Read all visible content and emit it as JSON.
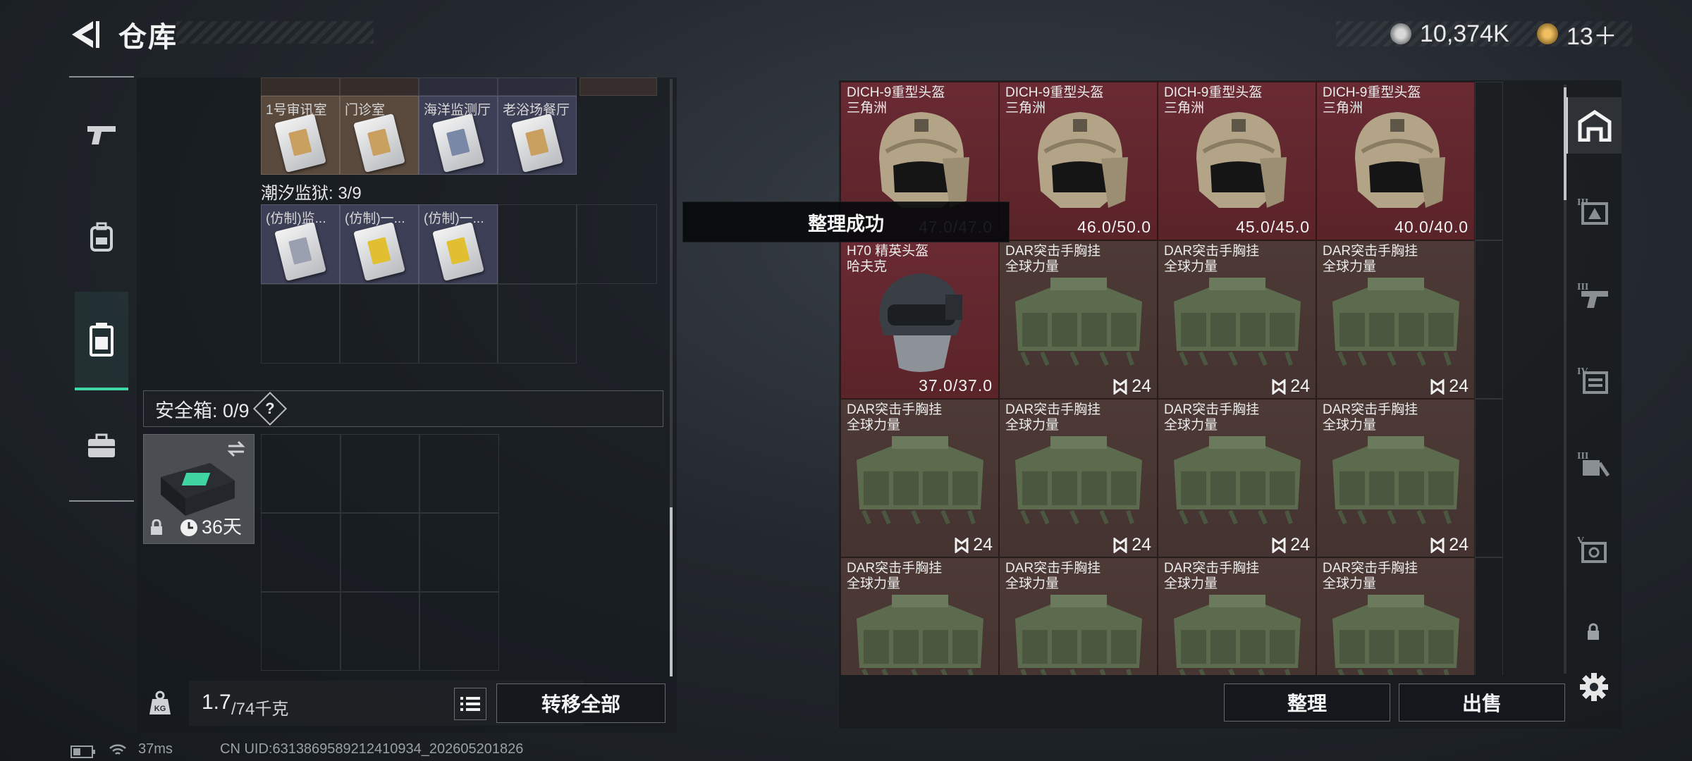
{
  "header": {
    "title": "仓库",
    "currency_1": "10,374K",
    "currency_2": "13＋"
  },
  "nav": {
    "items": [
      "weapon",
      "backpack",
      "vest",
      "case"
    ],
    "active": "vest"
  },
  "storage": {
    "room_row_labels": [
      "1号审讯室",
      "门诊室",
      "海洋监测厅",
      "老浴场餐厅"
    ],
    "prison_label": "潮汐监狱: 3/9",
    "prison_items": [
      "(仿制)监...",
      "(仿制)一...",
      "(仿制)一..."
    ],
    "safe_box_label": "安全箱: 0/9",
    "safe_box_help": "?",
    "safe_box_days": "36天",
    "weight_current": "1.7",
    "weight_max": "/74千克",
    "transfer_all": "转移全部"
  },
  "toast": "整理成功",
  "items": [
    {
      "name": "DICH-9重型头盔",
      "sub": "三角洲",
      "value": "47.0/47.0",
      "kind": "helmet",
      "bg": "red"
    },
    {
      "name": "DICH-9重型头盔",
      "sub": "三角洲",
      "value": "46.0/50.0",
      "kind": "helmet",
      "bg": "red"
    },
    {
      "name": "DICH-9重型头盔",
      "sub": "三角洲",
      "value": "45.0/45.0",
      "kind": "helmet",
      "bg": "red"
    },
    {
      "name": "DICH-9重型头盔",
      "sub": "三角洲",
      "value": "40.0/40.0",
      "kind": "helmet",
      "bg": "red"
    },
    {
      "name": "H70 精英头盔",
      "sub": "哈夫克",
      "value": "37.0/37.0",
      "kind": "helmet-dark",
      "bg": "red"
    },
    {
      "name": "DAR突击手胸挂",
      "sub": "全球力量",
      "cap": "24",
      "kind": "vest",
      "bg": "brown"
    },
    {
      "name": "DAR突击手胸挂",
      "sub": "全球力量",
      "cap": "24",
      "kind": "vest",
      "bg": "brown"
    },
    {
      "name": "DAR突击手胸挂",
      "sub": "全球力量",
      "cap": "24",
      "kind": "vest",
      "bg": "brown"
    },
    {
      "name": "DAR突击手胸挂",
      "sub": "全球力量",
      "cap": "24",
      "kind": "vest",
      "bg": "brown"
    },
    {
      "name": "DAR突击手胸挂",
      "sub": "全球力量",
      "cap": "24",
      "kind": "vest",
      "bg": "brown"
    },
    {
      "name": "DAR突击手胸挂",
      "sub": "全球力量",
      "cap": "24",
      "kind": "vest",
      "bg": "brown"
    },
    {
      "name": "DAR突击手胸挂",
      "sub": "全球力量",
      "cap": "24",
      "kind": "vest",
      "bg": "brown"
    },
    {
      "name": "DAR突击手胸挂",
      "sub": "全球力量",
      "kind": "vest",
      "bg": "brown"
    },
    {
      "name": "DAR突击手胸挂",
      "sub": "全球力量",
      "kind": "vest",
      "bg": "brown"
    },
    {
      "name": "DAR突击手胸挂",
      "sub": "全球力量",
      "kind": "vest",
      "bg": "brown"
    },
    {
      "name": "DAR突击手胸挂",
      "sub": "全球力量",
      "kind": "vest",
      "bg": "brown"
    }
  ],
  "actions": {
    "sort": "整理",
    "sell": "出售"
  },
  "side_tabs": [
    "home",
    "III",
    "III",
    "IV",
    "III",
    "V"
  ],
  "status_bar": {
    "ping": "37ms",
    "uid": "CN UID:6313869589212410934_202605201826"
  }
}
